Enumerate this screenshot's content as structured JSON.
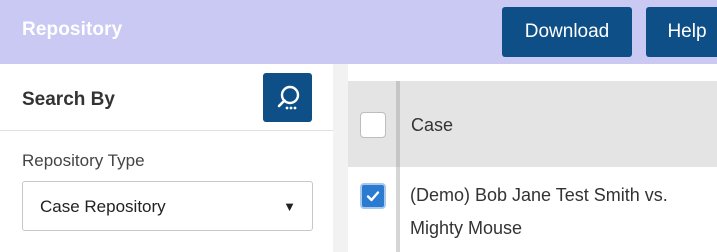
{
  "header": {
    "title": "Repository",
    "download_label": "Download",
    "help_label": "Help",
    "background_color": "#c9c9f3",
    "button_color": "#0d4f86"
  },
  "sidebar": {
    "heading": "Search By",
    "search_icon": "search-icon",
    "repository_type_label": "Repository Type",
    "repository_type_value": "Case Repository"
  },
  "table": {
    "header_checked": false,
    "column_case": "Case",
    "rows": [
      {
        "checked": true,
        "case": "(Demo) Bob Jane Test Smith vs. Mighty Mouse"
      }
    ]
  }
}
